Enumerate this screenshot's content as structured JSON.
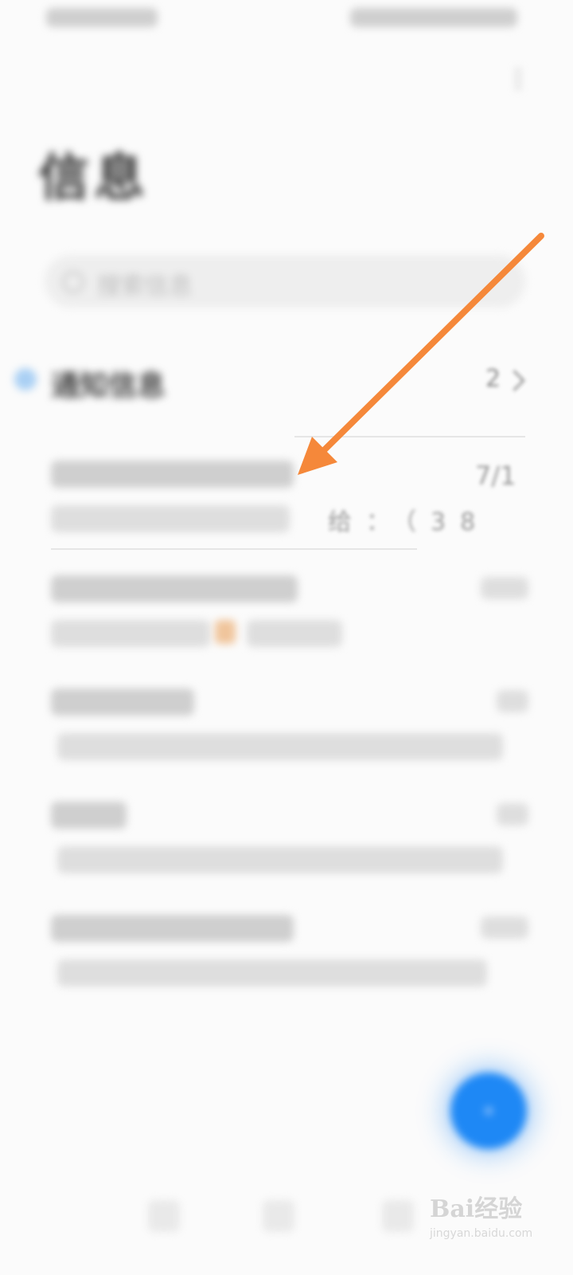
{
  "status_bar": {
    "left_text": "",
    "right_text": ""
  },
  "header": {
    "title": "信息"
  },
  "search": {
    "placeholder": "搜索信息"
  },
  "notifications": {
    "label": "通知信息",
    "count": "2"
  },
  "messages": [
    {
      "sender": "",
      "preview": "给：（38",
      "time": "7/1"
    },
    {
      "sender": "",
      "preview": "",
      "time": ""
    },
    {
      "sender": "",
      "preview": "",
      "time": ""
    },
    {
      "sender": "",
      "preview": "",
      "time": ""
    },
    {
      "sender": "",
      "preview": "",
      "time": ""
    }
  ],
  "compose": {
    "icon": "plus-icon"
  },
  "annotation": {
    "arrow_color": "#f5883a"
  },
  "watermark": {
    "main": "Bai经验",
    "sub": "jingyan.baidu.com"
  },
  "colors": {
    "accent": "#1e88f5",
    "background": "#fbfbfb"
  }
}
